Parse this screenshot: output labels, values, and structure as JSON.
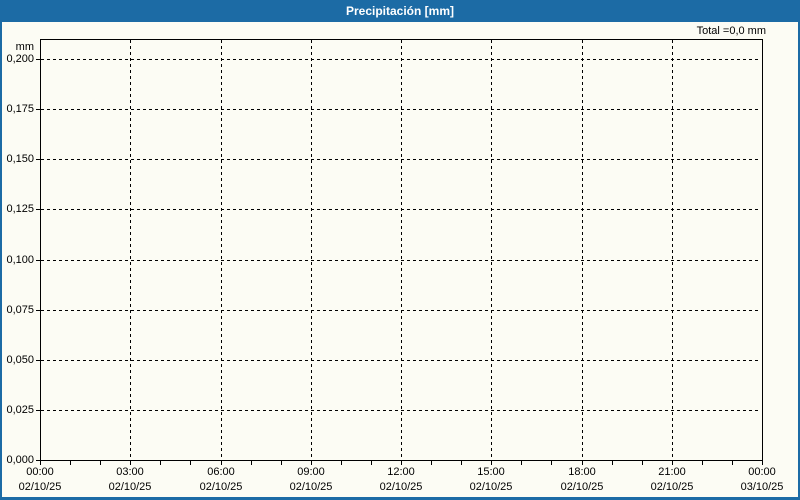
{
  "window": {
    "title": "Precipitación [mm]"
  },
  "colors": {
    "title_bar": "#1c6ba5",
    "window_border": "#1c6ba5",
    "background": "#fcfcf4",
    "grid": "#000000",
    "text": "#000000",
    "title_text": "#ffffff"
  },
  "summary": {
    "total_label": "Total =0,0 mm"
  },
  "y_axis": {
    "unit_label": "mm",
    "tick_labels": [
      "0,200",
      "0,175",
      "0,150",
      "0,125",
      "0,100",
      "0,075",
      "0,050",
      "0,025",
      "0,000"
    ],
    "tick_values": [
      0.2,
      0.175,
      0.15,
      0.125,
      0.1,
      0.075,
      0.05,
      0.025,
      0.0
    ],
    "min": 0,
    "max": 0.21
  },
  "x_axis": {
    "major_ticks": [
      {
        "time": "00:00",
        "date": "02/10/25"
      },
      {
        "time": "03:00",
        "date": "02/10/25"
      },
      {
        "time": "06:00",
        "date": "02/10/25"
      },
      {
        "time": "09:00",
        "date": "02/10/25"
      },
      {
        "time": "12:00",
        "date": "02/10/25"
      },
      {
        "time": "15:00",
        "date": "02/10/25"
      },
      {
        "time": "18:00",
        "date": "02/10/25"
      },
      {
        "time": "21:00",
        "date": "02/10/25"
      },
      {
        "time": "00:00",
        "date": "03/10/25"
      }
    ],
    "minor_tick_interval_hours": 1,
    "major_tick_interval_hours": 3
  },
  "chart_data": {
    "type": "line",
    "title": "Precipitación [mm]",
    "xlabel": "",
    "ylabel": "mm",
    "ylim": [
      0,
      0.21
    ],
    "xlim": [
      "02/10/25 00:00",
      "03/10/25 00:00"
    ],
    "x": [
      "02/10/25 00:00",
      "02/10/25 03:00",
      "02/10/25 06:00",
      "02/10/25 09:00",
      "02/10/25 12:00",
      "02/10/25 15:00",
      "02/10/25 18:00",
      "02/10/25 21:00",
      "03/10/25 00:00"
    ],
    "series": [
      {
        "name": "Precipitación",
        "values": [
          0,
          0,
          0,
          0,
          0,
          0,
          0,
          0,
          0
        ]
      }
    ],
    "total": "0,0 mm",
    "grid": true,
    "grid_style": "dashed",
    "legend_position": "none"
  }
}
